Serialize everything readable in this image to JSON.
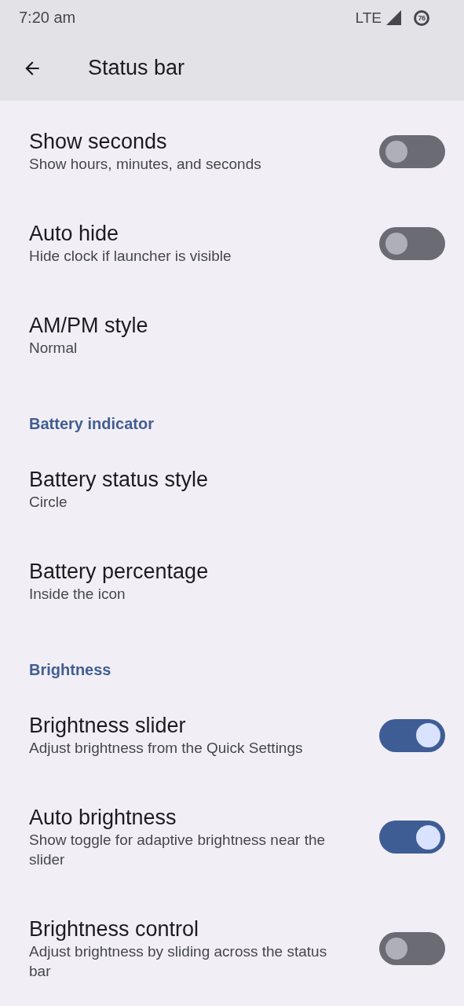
{
  "status_bar": {
    "time": "7:20 am",
    "network": "LTE",
    "battery_percent": "76"
  },
  "toolbar": {
    "title": "Status bar"
  },
  "sections": [
    {
      "items": [
        {
          "title": "Show seconds",
          "summary": "Show hours, minutes, and seconds",
          "kind": "switch",
          "on": false
        },
        {
          "title": "Auto hide",
          "summary": "Hide clock if launcher is visible",
          "kind": "switch",
          "on": false
        },
        {
          "title": "AM/PM style",
          "summary": "Normal",
          "kind": "list"
        }
      ]
    },
    {
      "header": "Battery indicator",
      "items": [
        {
          "title": "Battery status style",
          "summary": "Circle",
          "kind": "list"
        },
        {
          "title": "Battery percentage",
          "summary": "Inside the icon",
          "kind": "list"
        }
      ]
    },
    {
      "header": "Brightness",
      "items": [
        {
          "title": "Brightness slider",
          "summary": "Adjust brightness from the Quick Settings",
          "kind": "switch",
          "on": true
        },
        {
          "title": "Auto brightness",
          "summary": "Show toggle for adaptive brightness near the slider",
          "kind": "switch",
          "on": true
        },
        {
          "title": "Brightness control",
          "summary": "Adjust brightness by sliding across the status bar",
          "kind": "switch",
          "on": false
        }
      ]
    }
  ]
}
